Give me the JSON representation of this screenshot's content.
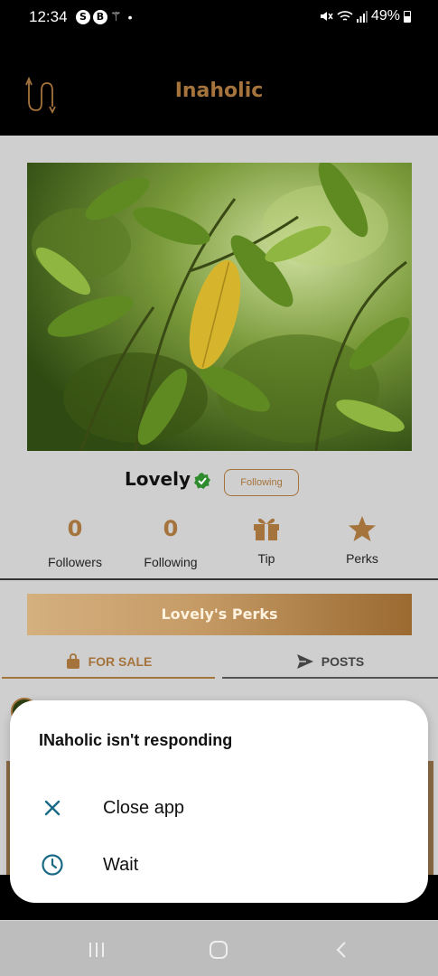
{
  "status_bar": {
    "time": "12:34",
    "notif_icons": [
      "S",
      "B"
    ],
    "wand_glyph": "⚚",
    "dot": "•",
    "battery": "49%",
    "icons": [
      "mute-icon",
      "wifi-icon",
      "signal-icon",
      "battery-icon"
    ]
  },
  "header": {
    "title": "Inaholic",
    "accent_color": "#a5733c"
  },
  "profile": {
    "name": "Lovely",
    "follow_label": "Following",
    "verified_color": "#2e8b2e"
  },
  "stats": [
    {
      "value": "0",
      "label": "Followers"
    },
    {
      "value": "0",
      "label": "Following"
    },
    {
      "icon": "gift-icon",
      "label": "Tip"
    },
    {
      "icon": "star-icon",
      "label": "Perks"
    }
  ],
  "perks_banner": {
    "label": "Lovely's Perks"
  },
  "tabs": [
    {
      "label": "FOR SALE",
      "icon": "shopping-bag-icon",
      "active": true
    },
    {
      "label": "POSTS",
      "icon": "send-icon",
      "active": false
    }
  ],
  "dialog": {
    "title": "INaholic isn't responding",
    "options": [
      {
        "label": "Close app",
        "icon": "close-icon"
      },
      {
        "label": "Wait",
        "icon": "clock-icon"
      }
    ],
    "icon_color": "#1a6a86"
  },
  "nav_bar": {
    "buttons": [
      "recent-apps-icon",
      "home-icon",
      "back-icon"
    ]
  }
}
